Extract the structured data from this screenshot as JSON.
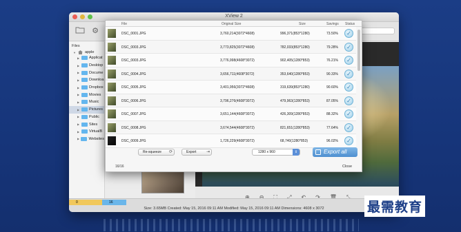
{
  "window": {
    "title": "XView 2"
  },
  "sidebar": {
    "title": "Files",
    "root": "apple",
    "items": [
      {
        "label": "Applicat",
        "selected": false
      },
      {
        "label": "Desktop",
        "selected": false
      },
      {
        "label": "Docume",
        "selected": false
      },
      {
        "label": "Downloa",
        "selected": false
      },
      {
        "label": "Dropbox",
        "selected": false
      },
      {
        "label": "Movies",
        "selected": false
      },
      {
        "label": "Music",
        "selected": false
      },
      {
        "label": "Pictures",
        "selected": true
      },
      {
        "label": "Public",
        "selected": false
      },
      {
        "label": "Sites",
        "selected": false
      },
      {
        "label": "VirtualB",
        "selected": false
      },
      {
        "label": "Websites",
        "selected": false
      }
    ]
  },
  "dialog": {
    "columns": {
      "file": "File",
      "original": "Original Size",
      "size": "Size",
      "savings": "Savings",
      "status": "Status"
    },
    "rows": [
      {
        "file": "DSC_0001.JPG",
        "original": "3,760,214(3072*4608)",
        "size": "996,371(853*1280)",
        "savings": "73.50%",
        "dark": false
      },
      {
        "file": "DSC_0003.JPG",
        "original": "3,773,825(3072*4608)",
        "size": "782,033(853*1280)",
        "savings": "79.28%",
        "dark": false
      },
      {
        "file": "DSC_0003.JPG",
        "original": "3,776,998(4608*3072)",
        "size": "902,405(1280*853)",
        "savings": "76.21%",
        "dark": false
      },
      {
        "file": "DSC_0004.JPG",
        "original": "3,656,711(4608*3072)",
        "size": "353,640(1280*853)",
        "savings": "90.33%",
        "dark": false
      },
      {
        "file": "DSC_0005.JPG",
        "original": "3,401,956(3072*4608)",
        "size": "319,639(853*1280)",
        "savings": "90.60%",
        "dark": false
      },
      {
        "file": "DSC_0006.JPG",
        "original": "3,796,276(4608*3072)",
        "size": "479,963(1280*853)",
        "savings": "87.05%",
        "dark": false
      },
      {
        "file": "DSC_0007.JPG",
        "original": "3,651,144(4608*3072)",
        "size": "426,309(1280*853)",
        "savings": "88.32%",
        "dark": false
      },
      {
        "file": "DSC_0008.JPG",
        "original": "3,674,544(4608*3072)",
        "size": "821,651(1280*853)",
        "savings": "77.64%",
        "dark": false
      },
      {
        "file": "DSC_0009.JPG",
        "original": "1,726,229(4608*3072)",
        "size": "68,740(1280*853)",
        "savings": "96.02%",
        "dark": true
      }
    ],
    "buttons": {
      "resqueeze": "Re-squeeze",
      "export": "Export",
      "export_all": "Export all",
      "close": "Close"
    },
    "resolution": "1280 x 960",
    "count": "16/16"
  },
  "bottom": {
    "tag_a": "0",
    "tag_b": "16",
    "status": "Size: 3.65MB    Created: May 15, 2016 09:11 AM    Modified: May 15, 2016 09:11 AM    Dimensions: 4608 x 3072"
  },
  "brand": "最需教育",
  "icons": [
    "folder-icon",
    "gear-icon",
    "house-icon",
    "check-icon",
    "zoom-in-icon",
    "zoom-out-icon",
    "fit-icon",
    "rotate-left-icon",
    "rotate-right-icon",
    "trash-icon",
    "fullscreen-icon"
  ]
}
